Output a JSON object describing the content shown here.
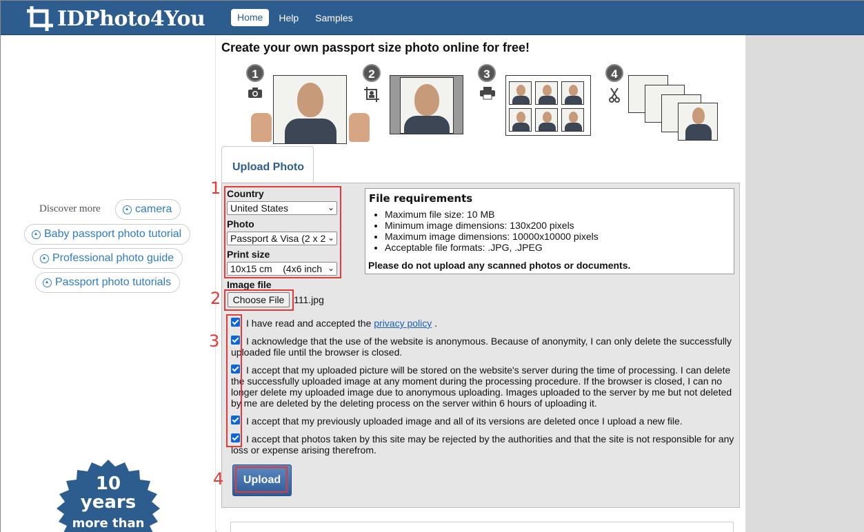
{
  "nav": {
    "logo_text": "IDPhoto4You",
    "home": "Home",
    "help": "Help",
    "samples": "Samples"
  },
  "sidebar": {
    "discover": "Discover more",
    "links": [
      "camera",
      "Baby passport photo tutorial",
      "Professional photo guide",
      "Passport photo tutorials"
    ],
    "badge": {
      "line1": "10",
      "line2": "years",
      "line3": "more than"
    }
  },
  "headline": "Create your own passport size photo online for free!",
  "steps": [
    "1",
    "2",
    "3",
    "4"
  ],
  "tab": "Upload Photo",
  "form": {
    "country_label": "Country",
    "country_value": "United States",
    "photo_label": "Photo",
    "photo_value": "Passport & Visa (2 x 2",
    "print_label": "Print size",
    "print_value": "10x15 cm    (4x6 inch",
    "image_label": "Image file",
    "choose_file": "Choose File",
    "file_name": "111.jpg",
    "upload": "Upload"
  },
  "requirements": {
    "title": "File requirements",
    "items": [
      "Maximum file size: 10 MB",
      "Minimum image dimensions: 130x200 pixels",
      "Maximum image dimensions: 10000x10000 pixels",
      "Acceptable file formats: .JPG, .JPEG"
    ],
    "warning": "Please do not upload any scanned photos or documents."
  },
  "consent": {
    "c1_pre": "I have read and accepted the ",
    "c1_link": "privacy policy",
    "c1_post": " .",
    "c2": "I acknowledge that the use of the website is anonymous. Because of anonymity, I can only delete the successfully uploaded file until the browser is closed.",
    "c3": "I accept that my uploaded picture will be stored on the website's server during the time of processing. I can delete the successfully uploaded image at any moment during the processing procedure. If the browser is closed, I can no longer delete my uploaded image due to anonymous uploading. Images uploaded to the server by me but not deleted by me are deleted by the deleting process on the server within 6 hours of uploading it.",
    "c4": "I accept that my previously uploaded image and all of its versions are deleted once I upload a new file.",
    "c5": "I accept that photos taken by this site may be rejected by the authorities and that the site is not responsible for any loss or expense arising therefrom."
  },
  "annotations": [
    "1",
    "2",
    "3",
    "4"
  ],
  "colors": {
    "brand": "#2d5c8f",
    "link": "#2f7bc4",
    "annotation": "#e53935"
  }
}
